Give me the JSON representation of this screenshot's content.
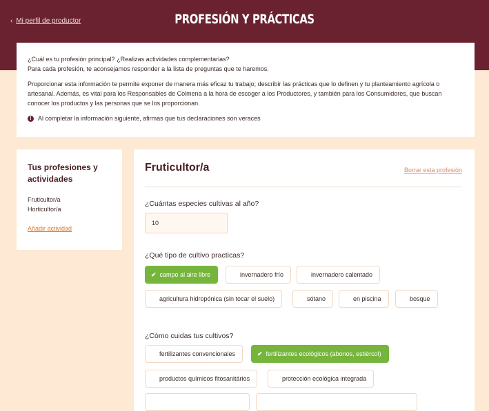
{
  "header": {
    "back_label": "Mi perfil de productor",
    "title": "PROFESIÓN Y PRÁCTICAS"
  },
  "intro": {
    "line1": "¿Cuál es tu profesión principal? ¿Realizas actividades complementarias?",
    "line2": "Para cada profesión, te aconsejamos responder a la lista de preguntas que te haremos.",
    "paragraph": "Proporcionar esta información te permite exponer de manera más eficaz tu trabajo; describir las prácticas que lo definen y tu planteamiento agrícola o artesanal. Además, es vital para los Responsables de Colmena a la hora de escoger a los Productores, y también para los Consumidores, que buscan conocer los productos y las personas que se los proporcionan.",
    "note": "Al completar la información siguiente, afirmas que tus declaraciones son veraces"
  },
  "sidebar": {
    "title": "Tus profesiones y actividades",
    "items": [
      {
        "label": "Fruticultor/a"
      },
      {
        "label": "Horticultor/a"
      }
    ],
    "add_label": "Añadir actividad"
  },
  "profession": {
    "title": "Fruticultor/a",
    "delete_label": "Borrar esta profesión",
    "q_species": "¿Cuántas especies cultivas al año?",
    "species_value": "10",
    "q_type": "¿Qué tipo de cultivo practicas?",
    "cultivation": [
      {
        "label": "campo al aire libre",
        "selected": true
      },
      {
        "label": "invernadero frío",
        "selected": false
      },
      {
        "label": "invernadero calentado",
        "selected": false
      },
      {
        "label": "agricultura hidropónica (sin tocar el suelo)",
        "selected": false
      },
      {
        "label": "sótano",
        "selected": false
      },
      {
        "label": "en piscina",
        "selected": false
      },
      {
        "label": "bosque",
        "selected": false
      }
    ],
    "q_care": "¿Cómo cuidas tus cultivos?",
    "care": [
      {
        "label": "fertilizantes convencionales",
        "selected": false
      },
      {
        "label": "fertilizantes ecológicos (abonos, estiércol)",
        "selected": true
      },
      {
        "label": "productos químicos fitosanitários",
        "selected": false
      },
      {
        "label": "protección ecológica integrada",
        "selected": false
      }
    ]
  },
  "colors": {
    "brand": "#6a2231",
    "background": "#fde9d4",
    "accent": "#d9772b",
    "selected": "#76b53c"
  },
  "icons": {
    "back": "chevron-left-icon",
    "info": "info-icon",
    "check": "check-icon"
  }
}
